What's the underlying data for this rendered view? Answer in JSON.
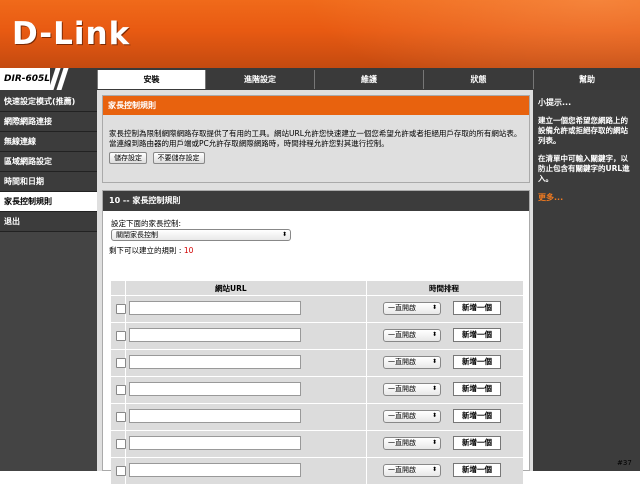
{
  "brand": {
    "logo": "D-Link",
    "model": "DIR-605L"
  },
  "tabs": [
    "安裝",
    "進階設定",
    "維護",
    "狀態",
    "幫助"
  ],
  "sidebar": {
    "items": [
      "快速設定模式(推薦)",
      "網際網路連接",
      "無線連線",
      "區域網路設定",
      "時間和日期",
      "家長控制規則",
      "退出"
    ]
  },
  "parental": {
    "title": "家長控制規則",
    "description": "家長控制為限制網際網路存取提供了有用的工具。網站URL允許您快速建立一個您希望允許或者拒絕用戶存取的所有網站表。當連線到路由器的用戶端或PC允許存取網際網路時，時間排程允許您對其進行控制。",
    "save_label": "儲存設定",
    "nosave_label": "不要儲存設定"
  },
  "rules": {
    "title": "10 -- 家長控制規則",
    "setup_label": "設定下面的家長控制:",
    "select_value": "關閉家長控制",
    "remaining_label": "剩下可以建立的規則 :",
    "remaining_count": "10",
    "col_url": "網站URL",
    "col_schedule": "時間排程",
    "rows": [
      {
        "schedule": "一直開啟",
        "add": "新增一個"
      },
      {
        "schedule": "一直開啟",
        "add": "新增一個"
      },
      {
        "schedule": "一直開啟",
        "add": "新增一個"
      },
      {
        "schedule": "一直開啟",
        "add": "新增一個"
      },
      {
        "schedule": "一直開啟",
        "add": "新增一個"
      },
      {
        "schedule": "一直開啟",
        "add": "新增一個"
      },
      {
        "schedule": "一直開啟",
        "add": "新增一個"
      }
    ]
  },
  "hints": {
    "title": "小提示...",
    "p1": "建立一個您希望您網路上的設備允許或拒絕存取的網站列表。",
    "p2": "在清單中可輸入關鍵字，以防止包含有關鍵字的URL進入。",
    "more": "更多..."
  },
  "badge": "#37"
}
